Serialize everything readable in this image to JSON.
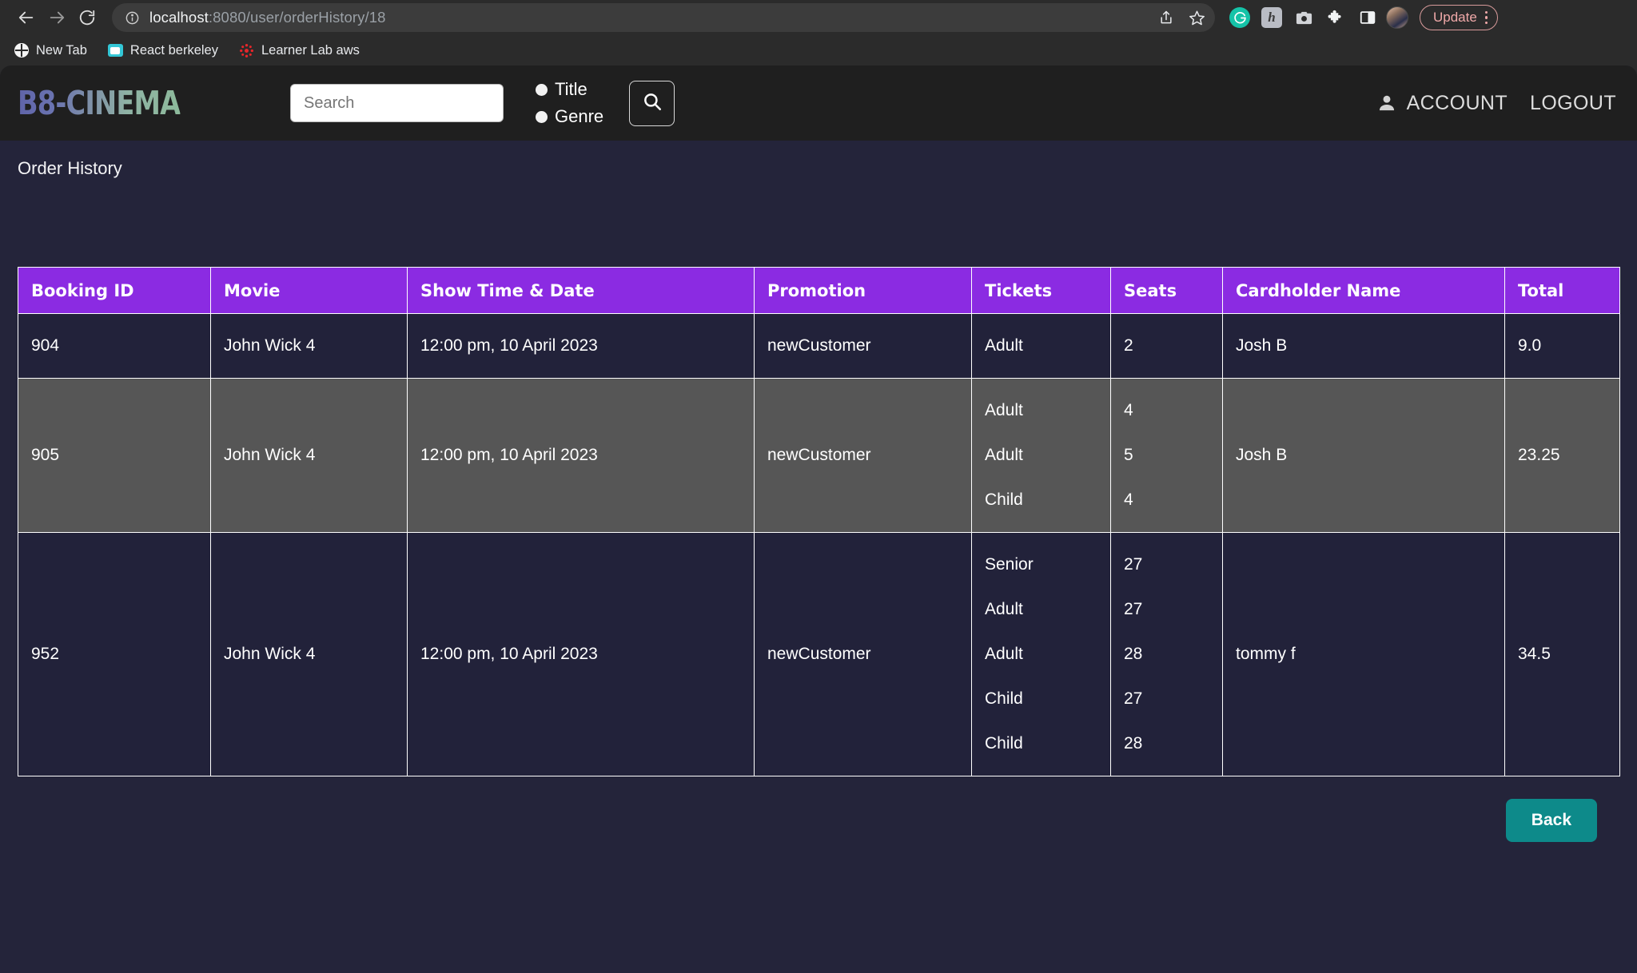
{
  "browser": {
    "back_icon": "back-arrow-icon",
    "forward_icon": "forward-arrow-icon",
    "reload_icon": "reload-icon",
    "url_host": "localhost",
    "url_rest": ":8080/user/orderHistory/18",
    "share_icon": "share-icon",
    "bookmark_icon": "star-icon",
    "extensions": [
      {
        "name": "grammarly-extension-icon",
        "glyph": "G"
      },
      {
        "name": "honey-extension-icon",
        "glyph": "h"
      },
      {
        "name": "screenshot-extension-icon",
        "glyph": ""
      },
      {
        "name": "extensions-puzzle-icon",
        "glyph": ""
      },
      {
        "name": "side-panel-icon",
        "glyph": ""
      }
    ],
    "profile_avatar": "profile-avatar",
    "update_label": "Update",
    "menu_icon": "kebab-menu-icon",
    "bookmarks": [
      {
        "label": "New Tab",
        "icon": "globe-icon"
      },
      {
        "label": "React berkeley",
        "icon": "react-app-icon"
      },
      {
        "label": "Learner Lab aws",
        "icon": "canvas-icon"
      }
    ]
  },
  "site": {
    "logo": "B8-CINEMA",
    "search": {
      "placeholder": "Search",
      "value": "",
      "search_icon": "magnifier-icon"
    },
    "search_modes": [
      {
        "label": "Title",
        "selected": false
      },
      {
        "label": "Genre",
        "selected": false
      }
    ],
    "account_label": "ACCOUNT",
    "account_icon": "person-icon",
    "logout_label": "LOGOUT"
  },
  "page": {
    "title": "Order History",
    "back_label": "Back",
    "accent_header": "#8b2be2",
    "accent_button": "#0d8a8a",
    "background": "#24243a",
    "row_hover": "#565656"
  },
  "table": {
    "columns": [
      "Booking ID",
      "Movie",
      "Show Time & Date",
      "Promotion",
      "Tickets",
      "Seats",
      "Cardholder Name",
      "Total"
    ],
    "rows": [
      {
        "booking_id": "904",
        "movie": "John Wick 4",
        "show_time": "12:00 pm, 10 April 2023",
        "promotion": "newCustomer",
        "tickets": [
          "Adult"
        ],
        "seats": [
          "2"
        ],
        "cardholder": "Josh B",
        "total": "9.0",
        "hover": false
      },
      {
        "booking_id": "905",
        "movie": "John Wick 4",
        "show_time": "12:00 pm, 10 April 2023",
        "promotion": "newCustomer",
        "tickets": [
          "Adult",
          "Adult",
          "Child"
        ],
        "seats": [
          "4",
          "5",
          "4"
        ],
        "cardholder": "Josh B",
        "total": "23.25",
        "hover": true
      },
      {
        "booking_id": "952",
        "movie": "John Wick 4",
        "show_time": "12:00 pm, 10 April 2023",
        "promotion": "newCustomer",
        "tickets": [
          "Senior",
          "Adult",
          "Adult",
          "Child",
          "Child"
        ],
        "seats": [
          "27",
          "27",
          "28",
          "27",
          "28"
        ],
        "cardholder": "tommy f",
        "total": "34.5",
        "hover": false
      }
    ]
  }
}
